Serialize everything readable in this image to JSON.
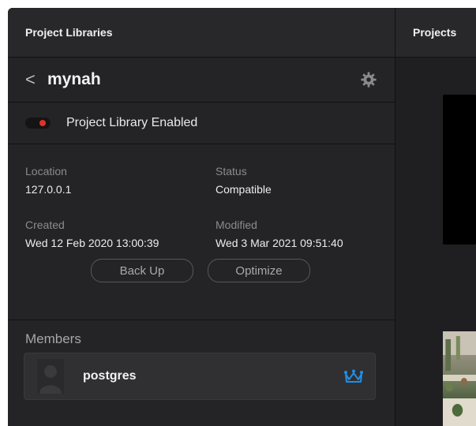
{
  "left_panel": {
    "header_title": "Project Libraries",
    "back_glyph": "<",
    "library_name": "mynah",
    "enabled_label": "Project Library Enabled",
    "enabled_dot_color": "#e0302b",
    "fields": {
      "location_label": "Location",
      "location_value": "127.0.0.1",
      "status_label": "Status",
      "status_value": "Compatible",
      "created_label": "Created",
      "created_value": "Wed 12 Feb 2020 13:00:39",
      "modified_label": "Modified",
      "modified_value": "Wed 3 Mar 2021 09:51:40"
    },
    "buttons": {
      "backup_label": "Back Up",
      "optimize_label": "Optimize"
    },
    "members_title": "Members",
    "members": [
      {
        "name": "postgres",
        "role_icon": "crown-icon",
        "role_color": "#1e90e8"
      }
    ]
  },
  "right_panel": {
    "header_title": "Projects"
  },
  "icons": {
    "back": "chevron-left-icon",
    "settings": "gear-icon",
    "avatar": "user-avatar-icon",
    "owner": "crown-icon"
  }
}
